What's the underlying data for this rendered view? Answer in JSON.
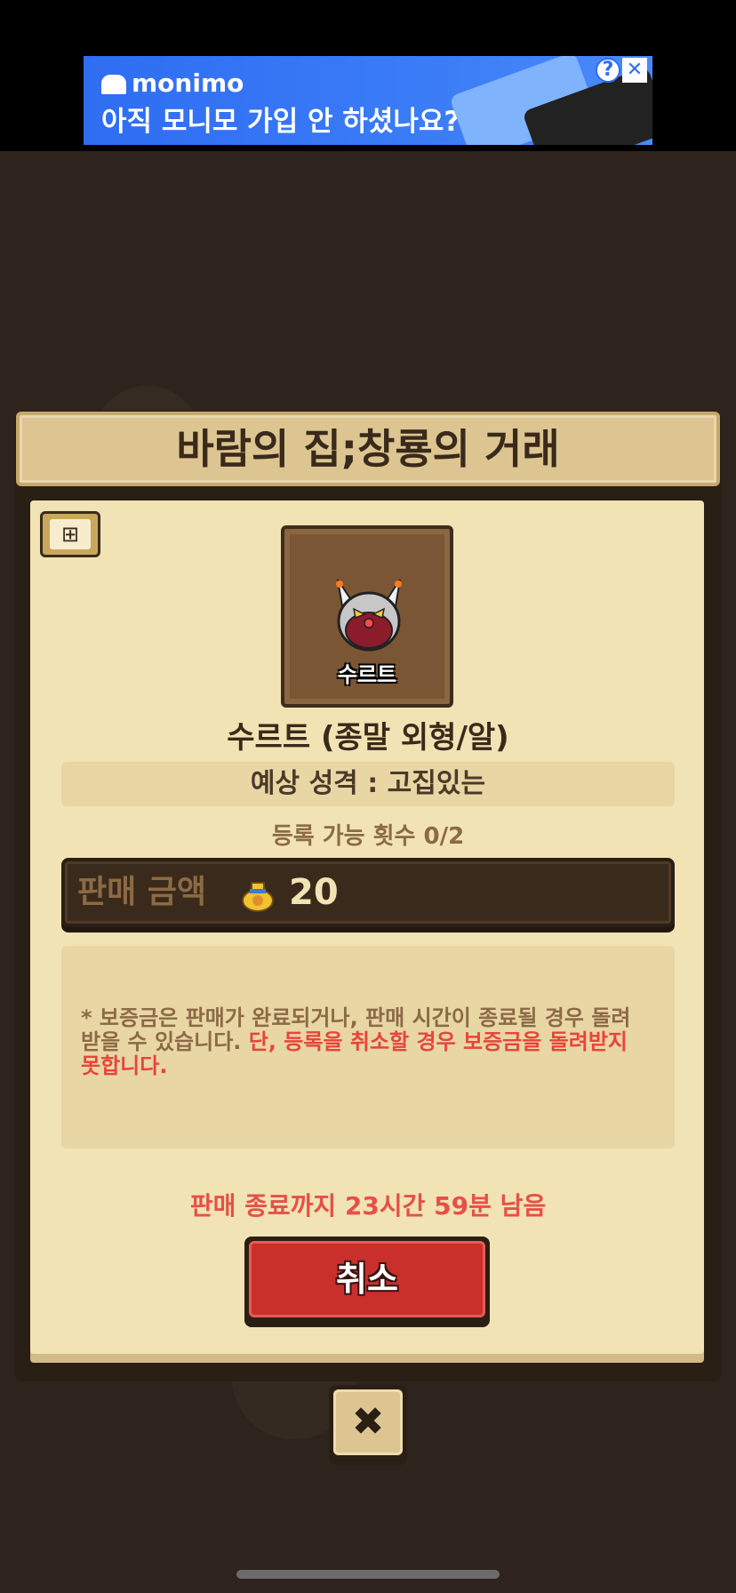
{
  "ad": {
    "brand": "monimo",
    "headline": "아직 모니모 가입 안 하셨나요?",
    "help_icon": "?",
    "close_icon": "✕"
  },
  "dialog": {
    "title": "바람의 집;창룡의 거래",
    "item": {
      "card_label": "수르트",
      "name": "수르트 (종말 외형/알)",
      "trait": "예상 성격 : 고집있는"
    },
    "registration_count": "등록 가능 횟수 0/2",
    "price": {
      "label": "판매 금액",
      "value": "20"
    },
    "notice": {
      "normal": "* 보증금은 판매가 완료되거나, 판매 시간이 종료될 경우 돌려받을 수 있습니다. ",
      "warning": "단, 등록을 취소할 경우 보증금을 돌려받지 못합니다."
    },
    "timer": "판매 종료까지 23시간 59분 남음",
    "cancel_label": "취소",
    "close_icon": "✖"
  }
}
